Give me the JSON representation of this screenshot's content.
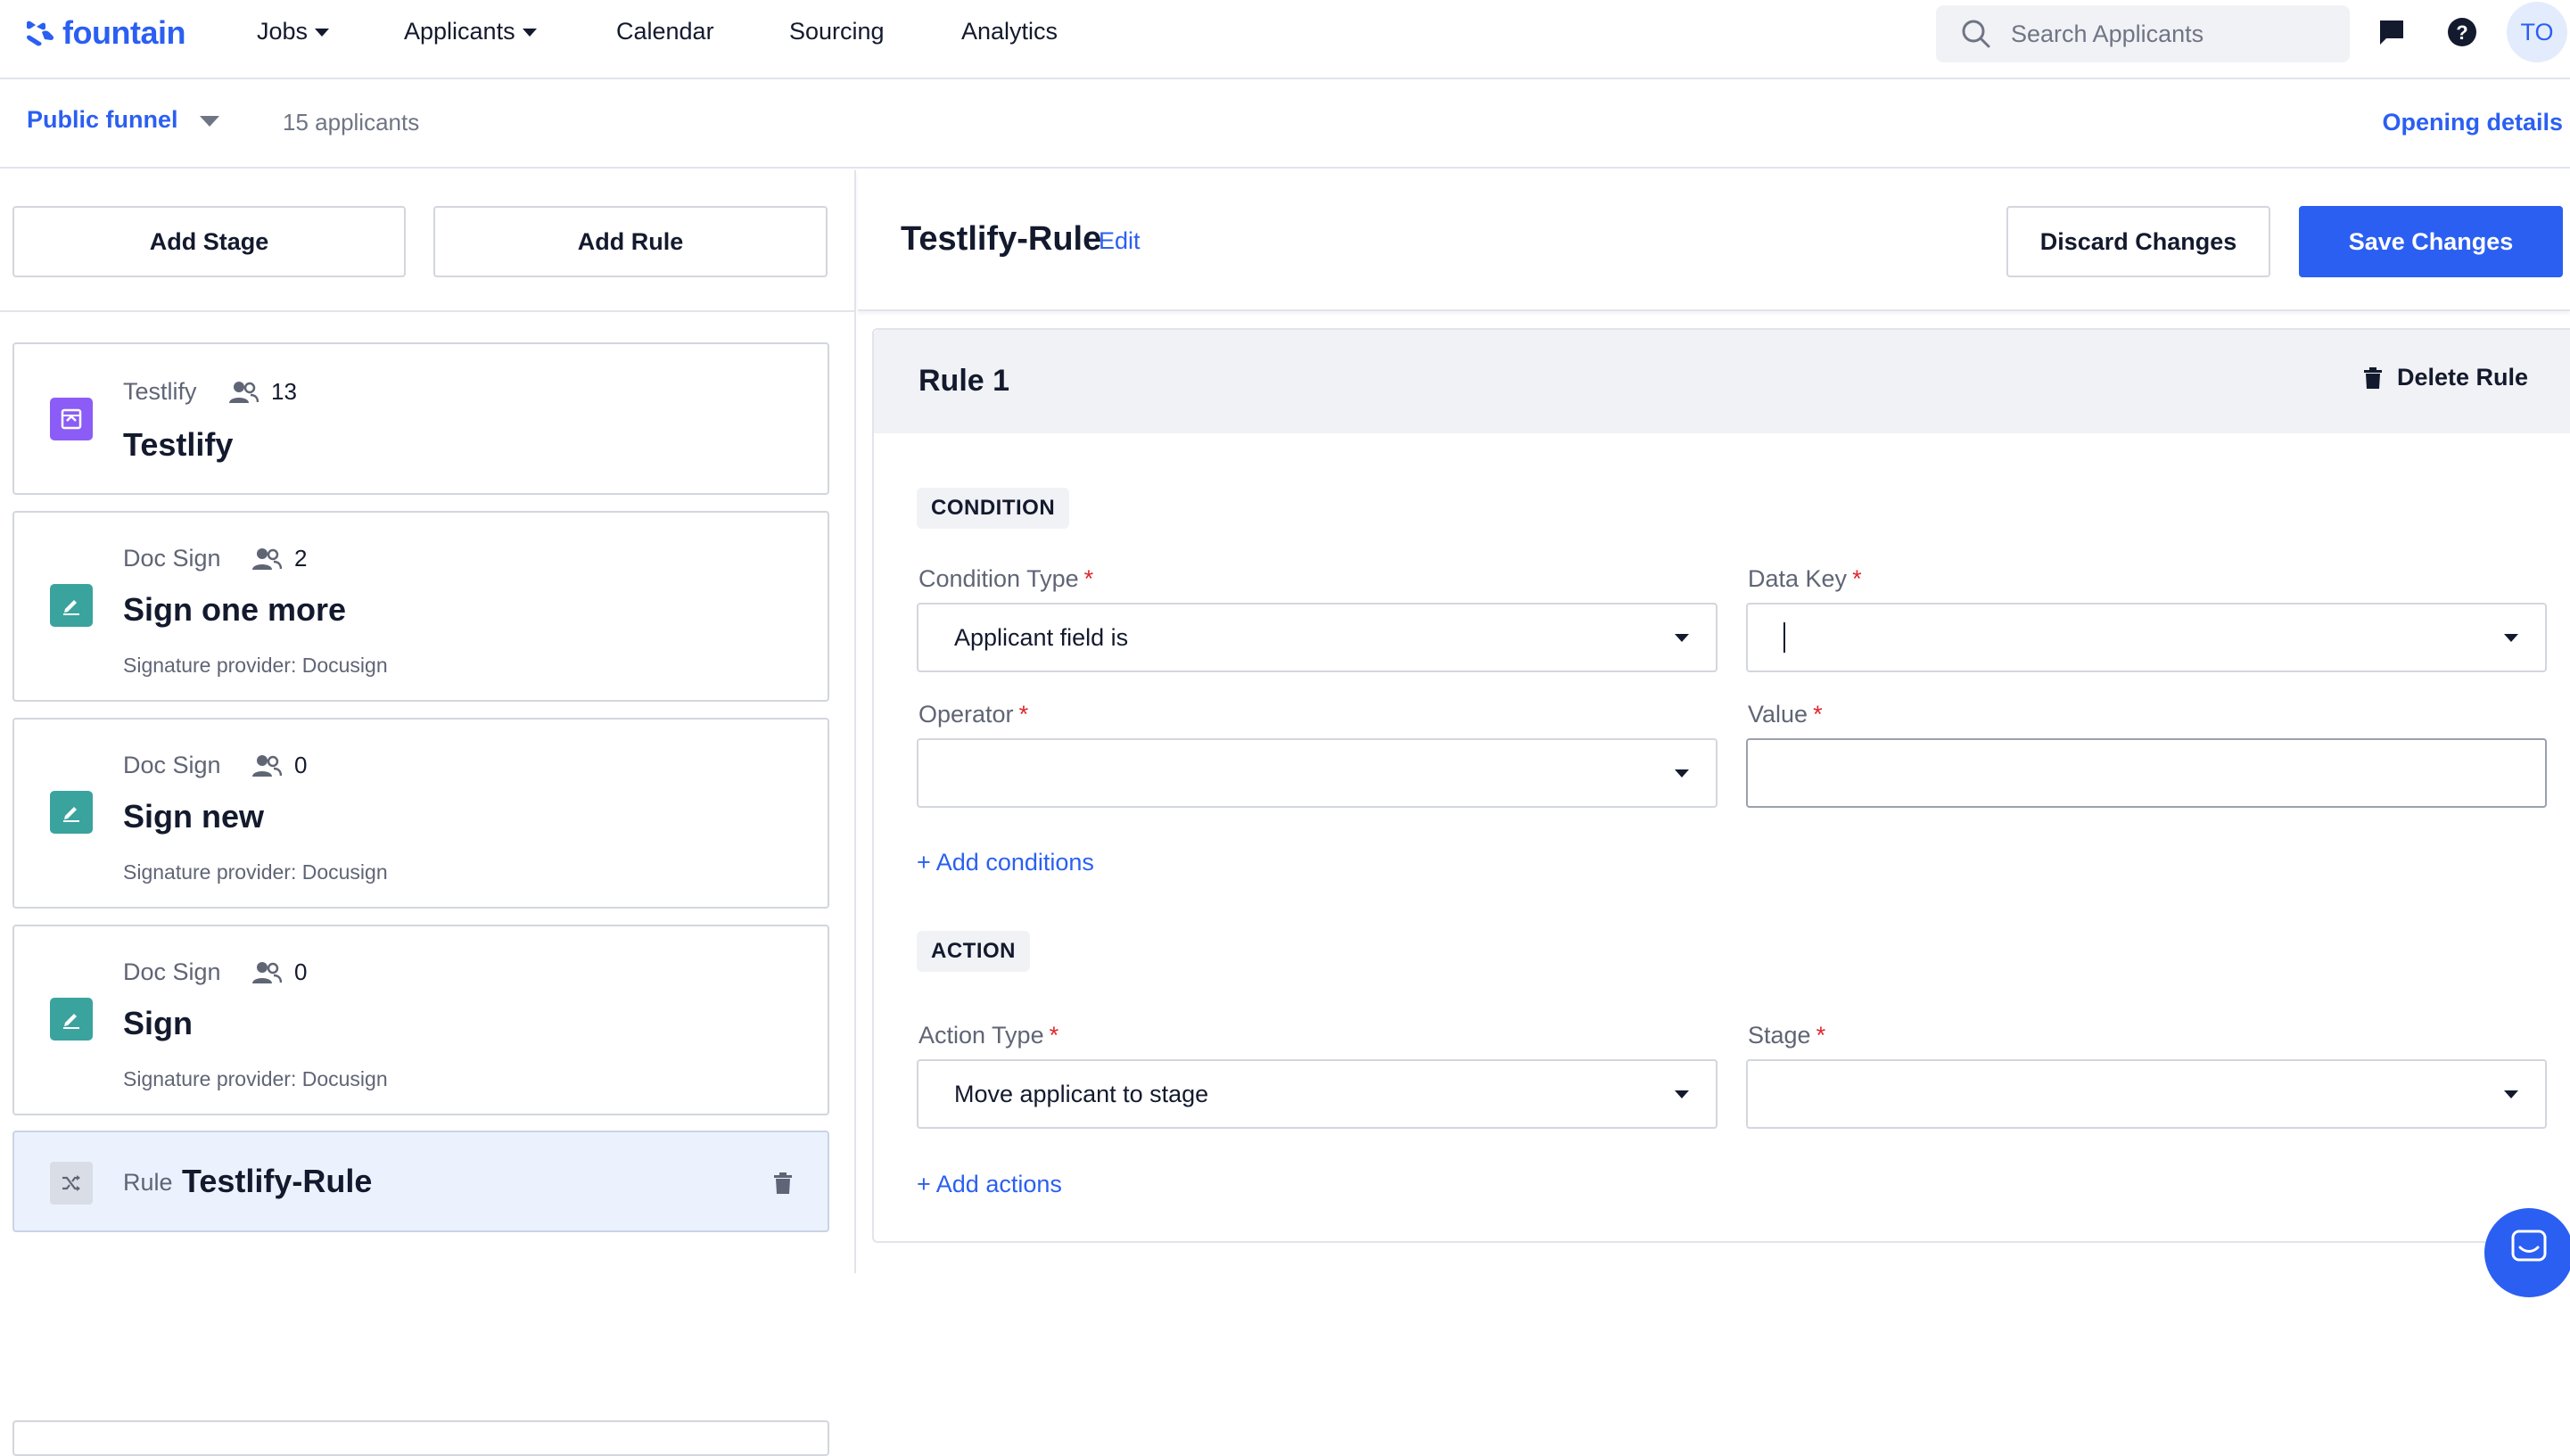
{
  "brand": {
    "name": "fountain",
    "color": "#2b5ff2"
  },
  "nav": {
    "items": [
      {
        "label": "Jobs",
        "dropdown": true
      },
      {
        "label": "Applicants",
        "dropdown": true
      },
      {
        "label": "Calendar",
        "dropdown": false
      },
      {
        "label": "Sourcing",
        "dropdown": false
      },
      {
        "label": "Analytics",
        "dropdown": false
      }
    ],
    "search_placeholder": "Search Applicants",
    "icons": [
      "chat-icon",
      "help-icon"
    ],
    "avatar_initials": "TO"
  },
  "subheader": {
    "funnel_label": "Public funnel",
    "applicant_count": "15 applicants",
    "opening_details": "Opening details"
  },
  "left_panel": {
    "add_stage": "Add Stage",
    "add_rule": "Add Rule",
    "stages": [
      {
        "type": "Testlify",
        "count": "13",
        "title": "Testlify",
        "subtitle": "",
        "icon": "testlify-icon",
        "icon_color": "#8b5cf6"
      },
      {
        "type": "Doc Sign",
        "count": "2",
        "title": "Sign one more",
        "subtitle": "Signature provider: Docusign",
        "icon": "doc-sign-icon",
        "icon_color": "#3aa39e"
      },
      {
        "type": "Doc Sign",
        "count": "0",
        "title": "Sign new",
        "subtitle": "Signature provider: Docusign",
        "icon": "doc-sign-icon",
        "icon_color": "#3aa39e"
      },
      {
        "type": "Doc Sign",
        "count": "0",
        "title": "Sign",
        "subtitle": "Signature provider: Docusign",
        "icon": "doc-sign-icon",
        "icon_color": "#3aa39e"
      }
    ],
    "rule_card": {
      "type": "Rule",
      "title": "Testlify-Rule",
      "icon": "shuffle-icon"
    }
  },
  "rule_editor": {
    "title": "Testlify-Rule",
    "edit_label": "Edit",
    "discard_label": "Discard Changes",
    "save_label": "Save Changes",
    "rule": {
      "name": "Rule 1",
      "delete_label": "Delete Rule",
      "condition_section": "CONDITION",
      "condition_type_label": "Condition Type",
      "condition_type_value": "Applicant field is",
      "data_key_label": "Data Key",
      "data_key_value": "",
      "operator_label": "Operator",
      "operator_value": "",
      "value_label": "Value",
      "value_value": "",
      "add_conditions": "+ Add conditions",
      "action_section": "ACTION",
      "action_type_label": "Action Type",
      "action_type_value": "Move applicant to stage",
      "stage_label": "Stage",
      "stage_value": "",
      "add_actions": "+ Add actions",
      "required_mark": "*"
    }
  },
  "colors": {
    "primary": "#2b5ff2",
    "required": "#e0262d",
    "selected_card_bg": "#ecf2fd"
  }
}
